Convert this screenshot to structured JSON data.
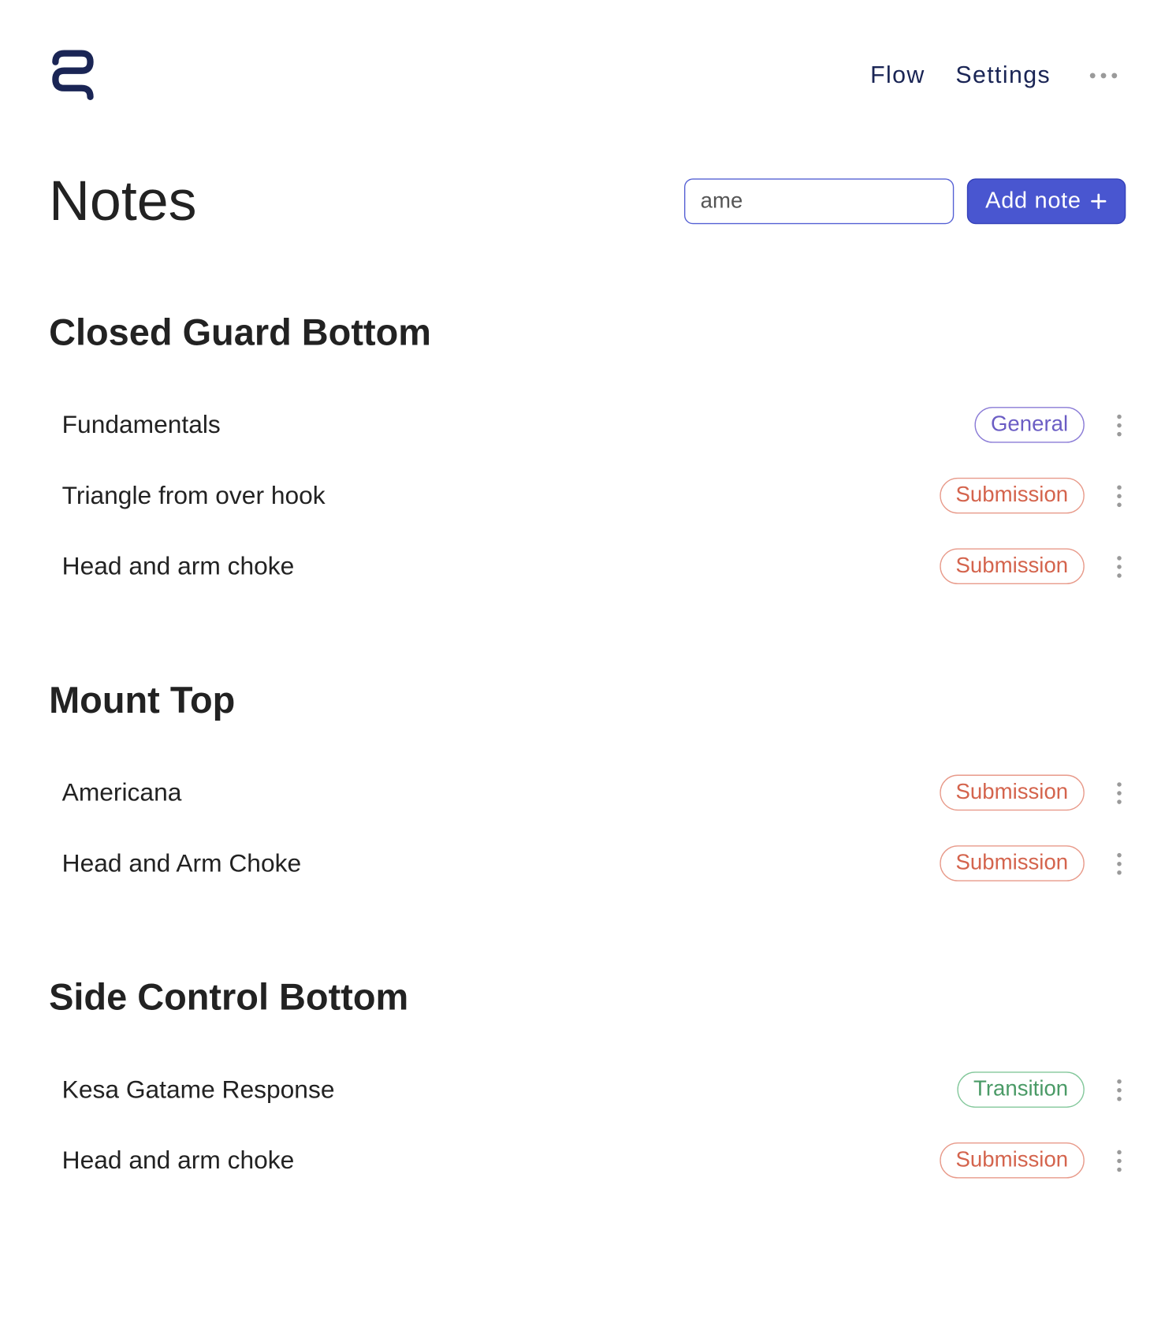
{
  "nav": {
    "flow": "Flow",
    "settings": "Settings"
  },
  "page": {
    "title": "Notes",
    "search_value": "ame",
    "add_button": "Add note"
  },
  "tags": {
    "general": "General",
    "submission": "Submission",
    "transition": "Transition"
  },
  "sections": [
    {
      "title": "Closed Guard Bottom",
      "notes": [
        {
          "title": "Fundamentals",
          "tag": "general"
        },
        {
          "title": "Triangle from over hook",
          "tag": "submission"
        },
        {
          "title": "Head and arm choke",
          "tag": "submission"
        }
      ]
    },
    {
      "title": "Mount Top",
      "notes": [
        {
          "title": "Americana",
          "tag": "submission"
        },
        {
          "title": "Head and Arm Choke",
          "tag": "submission"
        }
      ]
    },
    {
      "title": "Side Control Bottom",
      "notes": [
        {
          "title": "Kesa Gatame Response",
          "tag": "transition"
        },
        {
          "title": "Head and arm choke",
          "tag": "submission"
        }
      ]
    }
  ]
}
